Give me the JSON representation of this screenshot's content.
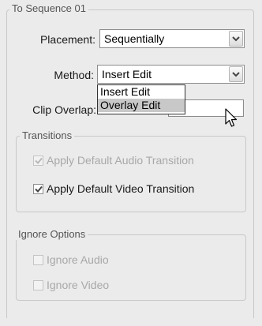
{
  "sequence_group": {
    "title": "To Sequence 01",
    "placement": {
      "label": "Placement:",
      "value": "Sequentially"
    },
    "method": {
      "label": "Method:",
      "value": "Insert Edit",
      "options": [
        "Insert Edit",
        "Overlay Edit"
      ],
      "highlighted": "Overlay Edit"
    },
    "clip_overlap": {
      "label": "Clip Overlap:"
    }
  },
  "transitions_group": {
    "title": "Transitions",
    "audio": {
      "label": "Apply Default Audio Transition",
      "checked": true,
      "enabled": false
    },
    "video": {
      "label": "Apply Default Video Transition",
      "checked": true,
      "enabled": true
    }
  },
  "ignore_group": {
    "title": "Ignore Options",
    "audio": {
      "label": "Ignore Audio",
      "checked": false,
      "enabled": false
    },
    "video": {
      "label": "Ignore Video",
      "checked": false,
      "enabled": false
    }
  },
  "colors": {
    "panel_bg": "#ebebeb",
    "group_border": "#c8c8c8",
    "highlight": "#c8c8c8",
    "disabled_text": "#a8a8a8"
  }
}
